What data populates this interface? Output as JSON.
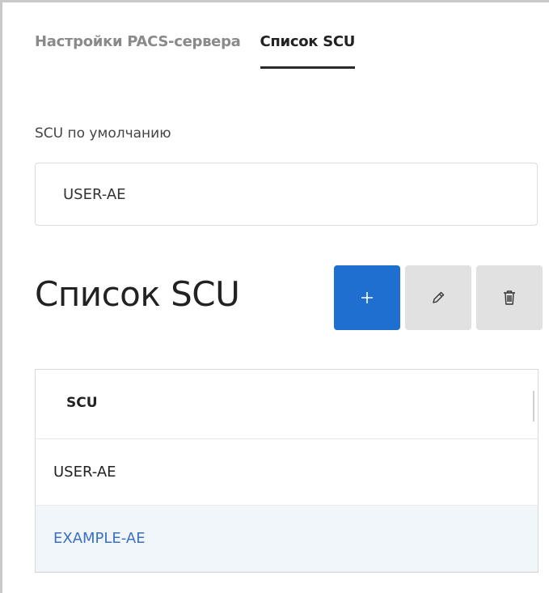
{
  "tabs": [
    {
      "label": "Настройки PACS-сервера",
      "active": false
    },
    {
      "label": "Список SCU",
      "active": true
    }
  ],
  "default_scu": {
    "label": "SCU по умолчанию",
    "value": "USER-AE"
  },
  "scu_list": {
    "title": "Список SCU",
    "toolbar": {
      "add_icon": "plus-icon",
      "edit_icon": "pencil-icon",
      "delete_icon": "trash-icon"
    },
    "table": {
      "columns": [
        "SCU"
      ],
      "rows": [
        {
          "scu": "USER-AE",
          "selected": false
        },
        {
          "scu": "EXAMPLE-AE",
          "selected": true
        }
      ]
    }
  },
  "colors": {
    "accent": "#1f6fd1",
    "selected_row_bg": "#f1f6fb",
    "selected_row_text": "#3b6fc2"
  }
}
